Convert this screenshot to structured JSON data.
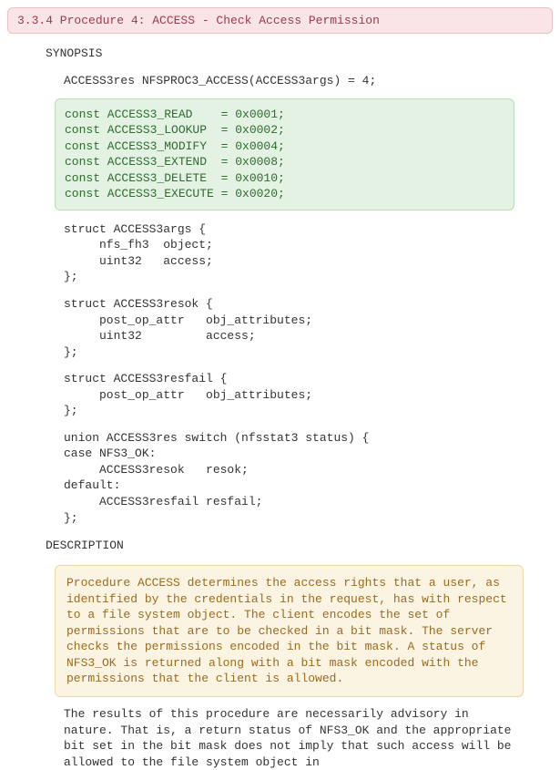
{
  "header": "3.3.4 Procedure 4: ACCESS - Check Access Permission",
  "synopsis_label": "SYNOPSIS",
  "signature": "ACCESS3res NFSPROC3_ACCESS(ACCESS3args) = 4;",
  "consts": "const ACCESS3_READ    = 0x0001;\nconst ACCESS3_LOOKUP  = 0x0002;\nconst ACCESS3_MODIFY  = 0x0004;\nconst ACCESS3_EXTEND  = 0x0008;\nconst ACCESS3_DELETE  = 0x0010;\nconst ACCESS3_EXECUTE = 0x0020;",
  "struct_args": "struct ACCESS3args {\n     nfs_fh3  object;\n     uint32   access;\n};",
  "struct_resok": "struct ACCESS3resok {\n     post_op_attr   obj_attributes;\n     uint32         access;\n};",
  "struct_resfail": "struct ACCESS3resfail {\n     post_op_attr   obj_attributes;\n};",
  "union_res": "union ACCESS3res switch (nfsstat3 status) {\ncase NFS3_OK:\n     ACCESS3resok   resok;\ndefault:\n     ACCESS3resfail resfail;\n};",
  "description_label": "DESCRIPTION",
  "desc_highlight": "Procedure ACCESS determines the access rights that a user, as identified by the credentials in the request, has with respect to a file system object. The client encodes the set of permissions that are to be checked in a bit mask. The server checks the permissions encoded in the bit mask. A status of NFS3_OK is returned along with a bit mask encoded with the permissions that the client is allowed.",
  "desc_para": "The results of this procedure are necessarily advisory in nature.  That is, a return status of NFS3_OK and the appropriate bit set in the bit mask does not imply that such access will be allowed to the file system object in"
}
